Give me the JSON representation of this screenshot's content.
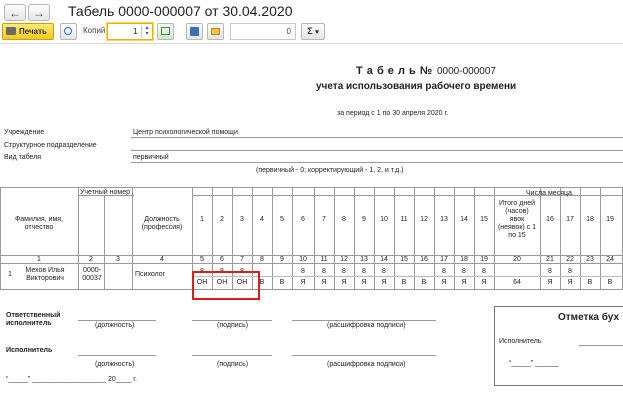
{
  "window": {
    "title": "Табель 0000-000007 от 30.04.2020",
    "back_icon": "←",
    "forward_icon": "→"
  },
  "toolbar": {
    "print_label": "Печать",
    "copies_label": "Копий:",
    "copies_value": "1",
    "page_value": "0",
    "sum_label": "Σ",
    "sum_arrow": "▾"
  },
  "doc": {
    "title_prefix": "Т а б е л ь №",
    "number": "0000-000007",
    "subtitle": "учета использования рабочего времени",
    "period": "за период с 1 по 30 апреля 2020 г.",
    "fields": [
      {
        "label": "Учреждение",
        "value": "Центр психологической помощи"
      },
      {
        "label": "Структурное подразделение",
        "value": ""
      },
      {
        "label": "Вид табеля",
        "value": "первичный"
      }
    ],
    "type_note": "(первичный - 0; корректирующий - 1, 2, и т.д.)",
    "header": {
      "fio": "Фамилия, имя,",
      "fio2": "отчество",
      "reg_num": "Учетный номер",
      "position": "Должность",
      "position2": "(профессия)",
      "days_of_month": "Числа месяца",
      "total1": "Итого дней",
      "total2": "(часов)",
      "total3": "явок",
      "total4": "(неявок) с 1",
      "total5": "по 15"
    },
    "day_headers": [
      "1",
      "2",
      "3",
      "4",
      "5",
      "6",
      "7",
      "8",
      "9",
      "10",
      "11",
      "12",
      "13",
      "14",
      "15",
      "16",
      "17",
      "18",
      "19"
    ],
    "col_numbers": [
      "1",
      "2",
      "3",
      "4",
      "5",
      "6",
      "7",
      "8",
      "9",
      "10",
      "11",
      "12",
      "13",
      "14",
      "15",
      "16",
      "17",
      "18",
      "19",
      "20",
      "21",
      "22",
      "23",
      "24"
    ],
    "row": {
      "num": "1",
      "name1": "Мехов Илья",
      "name2": "Викторович",
      "reg1": "0000-",
      "reg2": "00037",
      "position": "Психолог",
      "hours": [
        "8",
        "8",
        "8",
        "",
        "",
        "8",
        "8",
        "8",
        "8",
        "8",
        "",
        "",
        "8",
        "8",
        "8",
        "",
        "8",
        "8",
        ""
      ],
      "codes": [
        "ОН",
        "ОН",
        "ОН",
        "В",
        "В",
        "Я",
        "Я",
        "Я",
        "Я",
        "Я",
        "В",
        "В",
        "Я",
        "Я",
        "Я",
        "",
        "Я",
        "Я",
        "В",
        "В"
      ],
      "total_hours": "",
      "total_codes": "64"
    },
    "signatures": {
      "responsible1": "Ответственный",
      "responsible2": "исполнитель",
      "executor": "Исполнитель",
      "position_hint": "(должность)",
      "signature_hint": "(подпись)",
      "decode_hint": "(расшифровка подписи)",
      "date_line": "“_____” ___________________ 20____ г."
    },
    "stamp_box": {
      "title": "Отметка бух",
      "executor": "Исполнитель",
      "date": "“_____” ______"
    }
  }
}
